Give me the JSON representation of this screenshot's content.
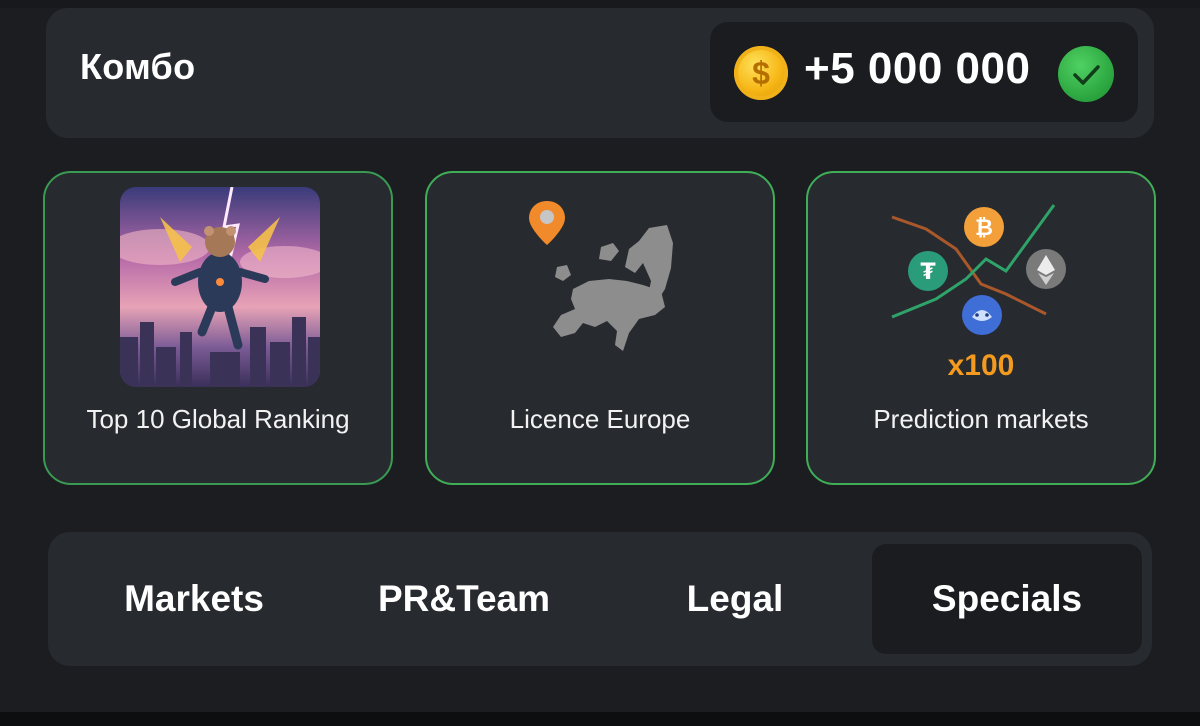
{
  "combo": {
    "title": "Комбо",
    "reward_amount": "+5 000 000",
    "coin_symbol": "$"
  },
  "cards": [
    {
      "label": "Top 10 Global Ranking",
      "image": "hamster-astronaut-flying-over-city"
    },
    {
      "label": "Licence Europe",
      "image": "europe-map-with-location-pin"
    },
    {
      "label": "Prediction markets",
      "image": "crypto-coins-chart",
      "multiplier": "x100"
    }
  ],
  "tabs": [
    {
      "label": "Markets",
      "active": false
    },
    {
      "label": "PR&Team",
      "active": false
    },
    {
      "label": "Legal",
      "active": false
    },
    {
      "label": "Specials",
      "active": true
    }
  ],
  "colors": {
    "background": "#1b1d21",
    "panel": "#272a2f",
    "card_border": "#3fae57",
    "coin_gold": "#f6b514",
    "check_green": "#2aa33e",
    "multiplier_orange": "#f39a1f"
  }
}
